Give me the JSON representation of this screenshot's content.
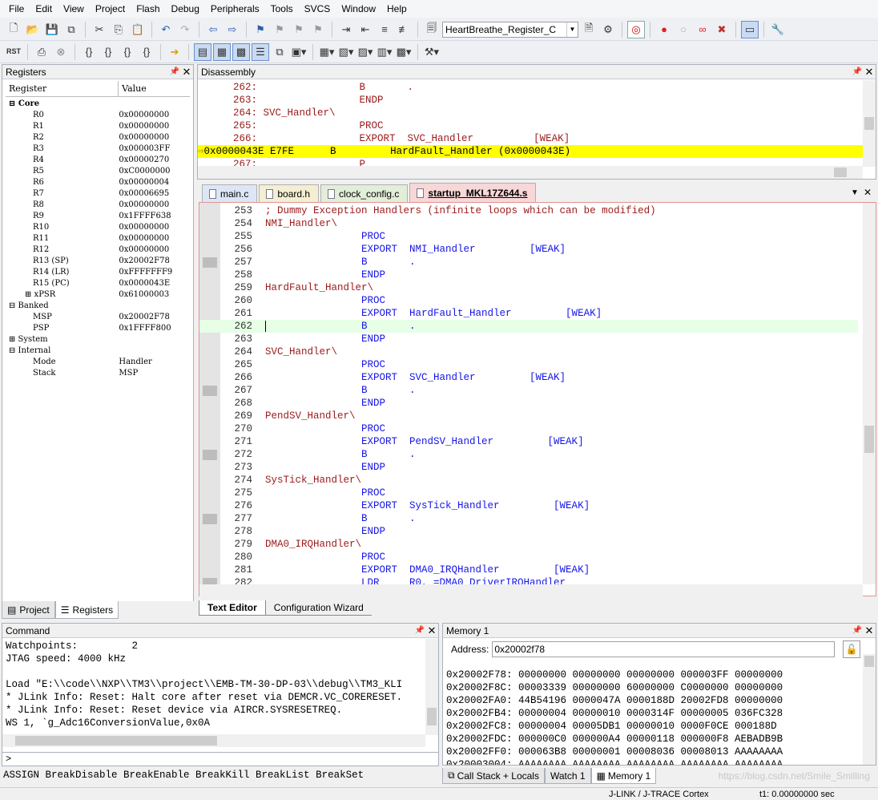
{
  "menu": [
    "File",
    "Edit",
    "View",
    "Project",
    "Flash",
    "Debug",
    "Peripherals",
    "Tools",
    "SVCS",
    "Window",
    "Help"
  ],
  "toolbar": {
    "target": "HeartBreathe_Register_C",
    "rst_label": "RST"
  },
  "registers": {
    "title": "Registers",
    "col_register": "Register",
    "col_value": "Value",
    "rows": [
      {
        "name": "⊟ Core",
        "value": "",
        "indent": 0,
        "bold": true
      },
      {
        "name": "R0",
        "value": "0x00000000",
        "indent": 3
      },
      {
        "name": "R1",
        "value": "0x00000000",
        "indent": 3
      },
      {
        "name": "R2",
        "value": "0x00000000",
        "indent": 3
      },
      {
        "name": "R3",
        "value": "0x000003FF",
        "indent": 3
      },
      {
        "name": "R4",
        "value": "0x00000270",
        "indent": 3
      },
      {
        "name": "R5",
        "value": "0xC0000000",
        "indent": 3
      },
      {
        "name": "R6",
        "value": "0x00000004",
        "indent": 3
      },
      {
        "name": "R7",
        "value": "0x00006695",
        "indent": 3
      },
      {
        "name": "R8",
        "value": "0x00000000",
        "indent": 3
      },
      {
        "name": "R9",
        "value": "0x1FFFF638",
        "indent": 3
      },
      {
        "name": "R10",
        "value": "0x00000000",
        "indent": 3
      },
      {
        "name": "R11",
        "value": "0x00000000",
        "indent": 3
      },
      {
        "name": "R12",
        "value": "0x00000000",
        "indent": 3
      },
      {
        "name": "R13 (SP)",
        "value": "0x20002F78",
        "indent": 3
      },
      {
        "name": "R14 (LR)",
        "value": "0xFFFFFFF9",
        "indent": 3
      },
      {
        "name": "R15 (PC)",
        "value": "0x0000043E",
        "indent": 3
      },
      {
        "name": "⊞ xPSR",
        "value": "0x61000003",
        "indent": 2
      },
      {
        "name": "⊟ Banked",
        "value": "",
        "indent": 0
      },
      {
        "name": "MSP",
        "value": "0x20002F78",
        "indent": 3
      },
      {
        "name": "PSP",
        "value": "0x1FFFF800",
        "indent": 3
      },
      {
        "name": "⊞ System",
        "value": "",
        "indent": 0
      },
      {
        "name": "⊟ Internal",
        "value": "",
        "indent": 0
      },
      {
        "name": "Mode",
        "value": "Handler",
        "indent": 3
      },
      {
        "name": "Stack",
        "value": "MSP",
        "indent": 3
      }
    ],
    "tab_project": "Project",
    "tab_registers": "Registers"
  },
  "disassembly": {
    "title": "Disassembly",
    "lines": [
      "    262:                 B       .",
      "    263:                 ENDP",
      "    264: SVC_Handler\\",
      "    265:                 PROC",
      "    266:                 EXPORT  SVC_Handler          [WEAK]",
      "0x0000043E E7FE      B         HardFault_Handler (0x0000043E)",
      "    267:                 P"
    ],
    "current_index": 5
  },
  "editor": {
    "tabs": [
      "main.c",
      "board.h",
      "clock_config.c",
      "startup_MKL17Z644.s"
    ],
    "active_tab": 3,
    "lines": [
      {
        "n": "253",
        "code": "; Dummy Exception Handlers (infinite loops which can be modified)",
        "type": "cmt"
      },
      {
        "n": "254",
        "code": "NMI_Handler\\",
        "type": "label"
      },
      {
        "n": "255",
        "code": "                PROC",
        "type": "kw"
      },
      {
        "n": "256",
        "code": "                EXPORT  NMI_Handler         [WEAK]",
        "type": "export"
      },
      {
        "n": "257",
        "code": "                B       .",
        "type": "b",
        "mark": true
      },
      {
        "n": "258",
        "code": "                ENDP",
        "type": "kw"
      },
      {
        "n": "259",
        "code": "HardFault_Handler\\",
        "type": "label"
      },
      {
        "n": "260",
        "code": "                PROC",
        "type": "kw"
      },
      {
        "n": "261",
        "code": "                EXPORT  HardFault_Handler         [WEAK]",
        "type": "export"
      },
      {
        "n": "262",
        "code": "                B       .",
        "type": "b",
        "current": true
      },
      {
        "n": "263",
        "code": "                ENDP",
        "type": "kw"
      },
      {
        "n": "264",
        "code": "SVC_Handler\\",
        "type": "label"
      },
      {
        "n": "265",
        "code": "                PROC",
        "type": "kw"
      },
      {
        "n": "266",
        "code": "                EXPORT  SVC_Handler         [WEAK]",
        "type": "export"
      },
      {
        "n": "267",
        "code": "                B       .",
        "type": "b",
        "mark": true
      },
      {
        "n": "268",
        "code": "                ENDP",
        "type": "kw"
      },
      {
        "n": "269",
        "code": "PendSV_Handler\\",
        "type": "label"
      },
      {
        "n": "270",
        "code": "                PROC",
        "type": "kw"
      },
      {
        "n": "271",
        "code": "                EXPORT  PendSV_Handler         [WEAK]",
        "type": "export"
      },
      {
        "n": "272",
        "code": "                B       .",
        "type": "b",
        "mark": true
      },
      {
        "n": "273",
        "code": "                ENDP",
        "type": "kw"
      },
      {
        "n": "274",
        "code": "SysTick_Handler\\",
        "type": "label"
      },
      {
        "n": "275",
        "code": "                PROC",
        "type": "kw"
      },
      {
        "n": "276",
        "code": "                EXPORT  SysTick_Handler         [WEAK]",
        "type": "export"
      },
      {
        "n": "277",
        "code": "                B       .",
        "type": "b",
        "mark": true
      },
      {
        "n": "278",
        "code": "                ENDP",
        "type": "kw"
      },
      {
        "n": "279",
        "code": "DMA0_IRQHandler\\",
        "type": "label"
      },
      {
        "n": "280",
        "code": "                PROC",
        "type": "kw"
      },
      {
        "n": "281",
        "code": "                EXPORT  DMA0_IRQHandler         [WEAK]",
        "type": "export"
      },
      {
        "n": "282",
        "code": "                LDR     R0, =DMA0_DriverIRQHandler",
        "type": "ldr",
        "mark": true
      }
    ],
    "bottom_tabs": [
      "Text Editor",
      "Configuration Wizard"
    ]
  },
  "command": {
    "title": "Command",
    "lines": [
      "Watchpoints:         2",
      "JTAG speed: 4000 kHz",
      "",
      "Load \"E:\\\\code\\\\NXP\\\\TM3\\\\project\\\\EMB-TM-30-DP-03\\\\debug\\\\TM3_KLI",
      "* JLink Info: Reset: Halt core after reset via DEMCR.VC_CORERESET.",
      "* JLink Info: Reset: Reset device via AIRCR.SYSRESETREQ.",
      "WS 1, `g_Adc16ConversionValue,0x0A"
    ],
    "prompt": ">",
    "hints": "ASSIGN BreakDisable BreakEnable BreakKill BreakList BreakSet"
  },
  "memory": {
    "title": "Memory 1",
    "address_label": "Address:",
    "address": "0x20002f78",
    "lines": [
      "0x20002F78: 00000000 00000000 00000000 000003FF 00000000",
      "0x20002F8C: 00003339 00000000 60000000 C0000000 00000000",
      "0x20002FA0: 44B54196 0000047A 0000188D 20002FD8 00000000",
      "0x20002FB4: 00000004 00000010 0000314F 00000005 036FC328",
      "0x20002FC8: 00000004 00005DB1 00000010 0000F0CE 000188D",
      "0x20002FDC: 000000C0 000000A4 00000118 000000F8 AEBADB9B",
      "0x20002FF0: 000063B8 00000001 00008036 00008013 AAAAAAAA",
      "0x20003004: AAAAAAAA AAAAAAAA AAAAAAAA AAAAAAAA AAAAAAAA"
    ],
    "tabs": [
      "Call Stack + Locals",
      "Watch 1",
      "Memory 1"
    ]
  },
  "status": {
    "debugger": "J-LINK / J-TRACE Cortex",
    "time": "t1: 0.00000000 sec",
    "watermark": "https://blog.csdn.net/Smile_Smilling"
  },
  "colors": {
    "current_line_yellow": "#ffff00",
    "current_line_green": "#e6ffe6",
    "keyword": "#1515e8",
    "label": "#9b1a1a",
    "active_tab": "#f7d7d7"
  }
}
